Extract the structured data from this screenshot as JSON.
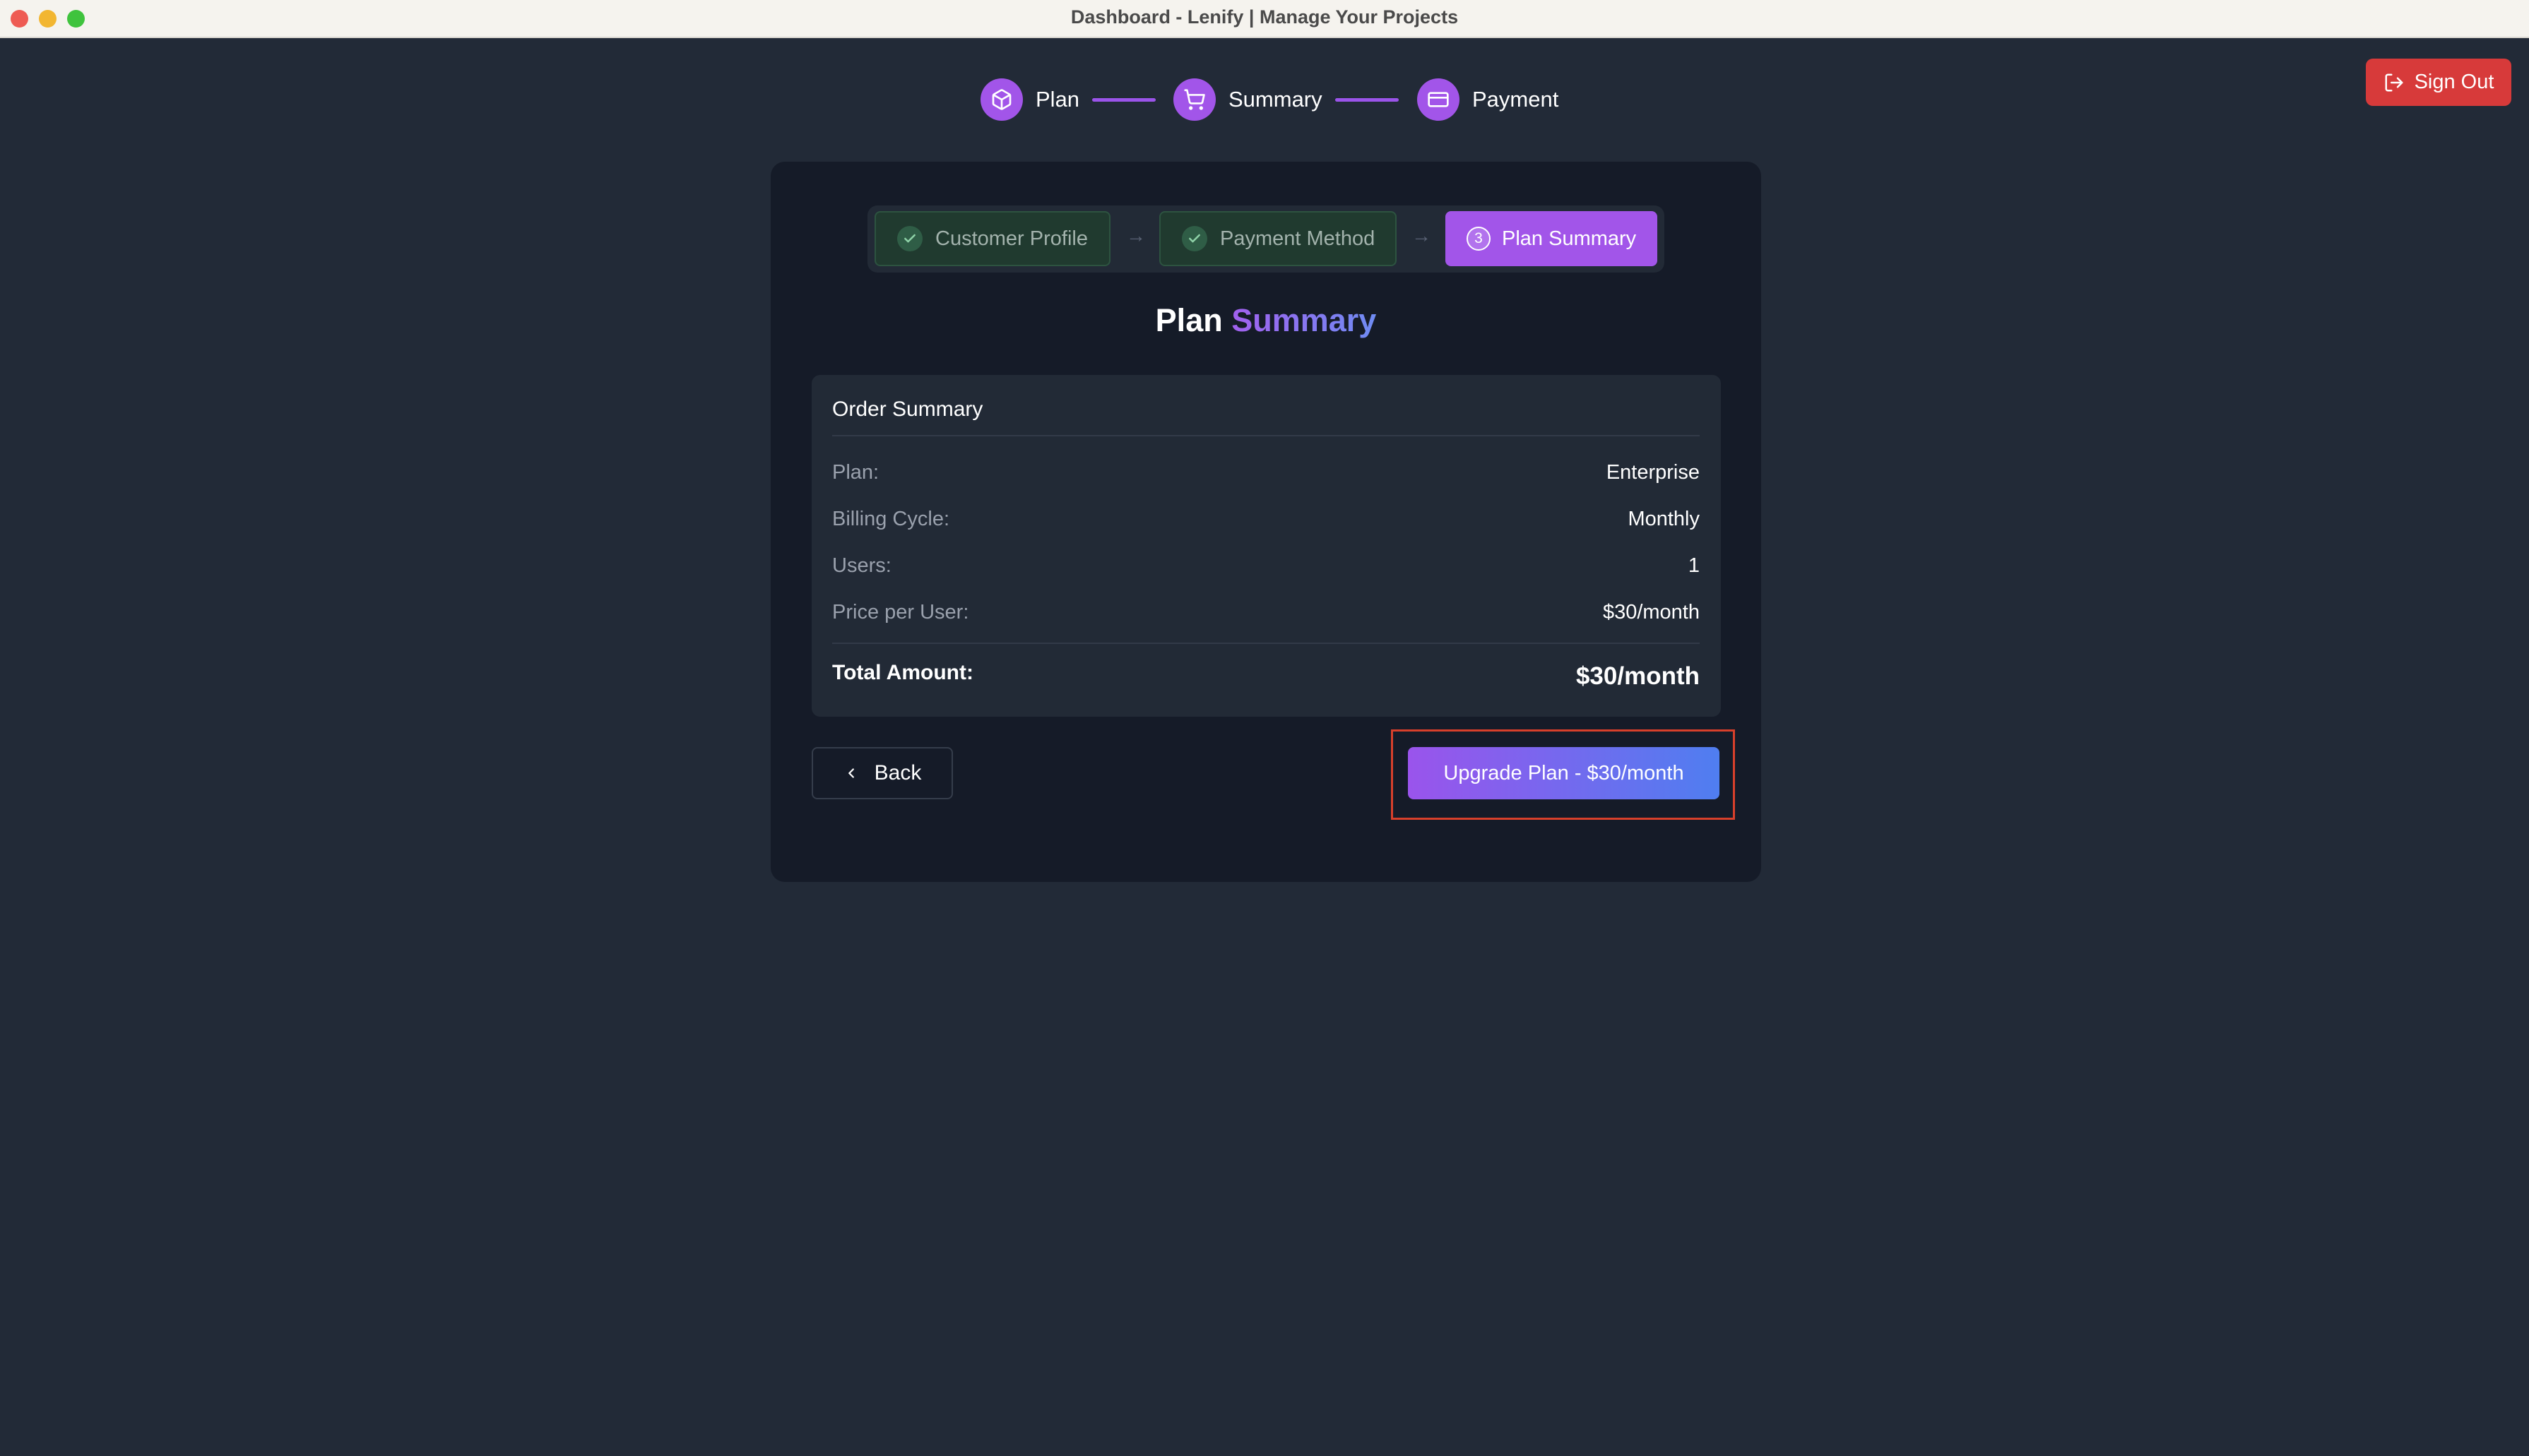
{
  "window": {
    "title": "Dashboard - Lenify | Manage Your Projects"
  },
  "header": {
    "sign_out_label": "Sign Out"
  },
  "top_steps": [
    {
      "label": "Plan",
      "icon": "box-icon"
    },
    {
      "label": "Summary",
      "icon": "cart-icon"
    },
    {
      "label": "Payment",
      "icon": "credit-card-icon"
    }
  ],
  "sub_steps": [
    {
      "label": "Customer Profile",
      "status": "completed"
    },
    {
      "label": "Payment Method",
      "status": "completed"
    },
    {
      "label": "Plan Summary",
      "status": "active",
      "number": "3"
    }
  ],
  "heading": {
    "part1": "Plan",
    "part2": "Summary"
  },
  "order_summary": {
    "title": "Order Summary",
    "rows": [
      {
        "label": "Plan:",
        "value": "Enterprise"
      },
      {
        "label": "Billing Cycle:",
        "value": "Monthly"
      },
      {
        "label": "Users:",
        "value": "1"
      },
      {
        "label": "Price per User:",
        "value": "$30/month"
      }
    ],
    "total_label": "Total Amount:",
    "total_value": "$30/month"
  },
  "actions": {
    "back_label": "Back",
    "upgrade_label": "Upgrade Plan - $30/month"
  },
  "colors": {
    "accent": "#a255e9",
    "danger": "#d73a3a",
    "background": "#222a37",
    "card": "#151b28"
  }
}
